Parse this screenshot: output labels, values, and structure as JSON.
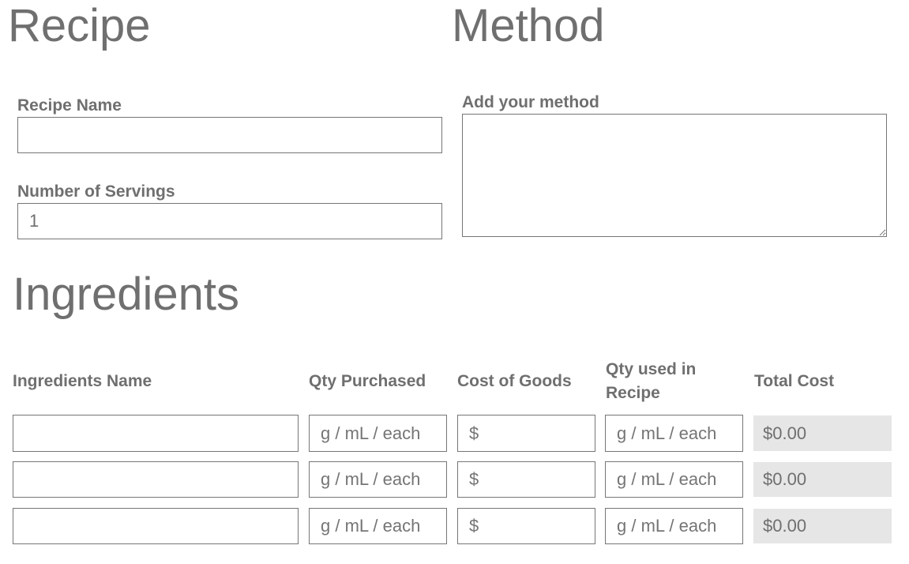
{
  "recipe": {
    "title": "Recipe",
    "name_label": "Recipe Name",
    "name_value": "",
    "servings_label": "Number of Servings",
    "servings_value": "1"
  },
  "method": {
    "title": "Method",
    "label": "Add your method",
    "value": ""
  },
  "ingredients": {
    "title": "Ingredients",
    "headers": {
      "name": "Ingredients Name",
      "qty_purchased": "Qty Purchased",
      "cost": "Cost of Goods",
      "qty_used": "Qty used in Recipe",
      "total": "Total Cost"
    },
    "placeholders": {
      "qty": "g / mL / each",
      "cost": "$"
    },
    "rows": [
      {
        "name": "",
        "qty_purchased": "",
        "cost": "",
        "qty_used": "",
        "total": "$0.00"
      },
      {
        "name": "",
        "qty_purchased": "",
        "cost": "",
        "qty_used": "",
        "total": "$0.00"
      },
      {
        "name": "",
        "qty_purchased": "",
        "cost": "",
        "qty_used": "",
        "total": "$0.00"
      }
    ]
  }
}
